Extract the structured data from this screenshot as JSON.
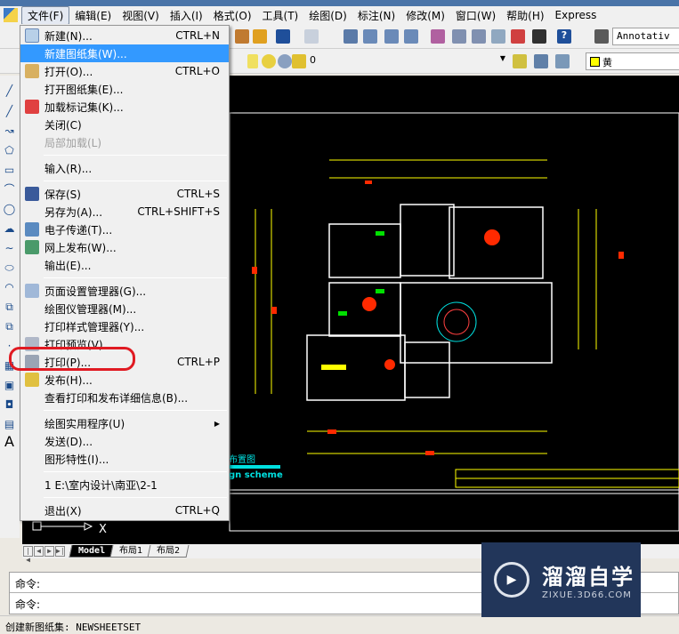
{
  "menubar": {
    "items": [
      "文件(F)",
      "编辑(E)",
      "视图(V)",
      "插入(I)",
      "格式(O)",
      "工具(T)",
      "绘图(D)",
      "标注(N)",
      "修改(M)",
      "窗口(W)",
      "帮助(H)",
      "Express"
    ]
  },
  "toolbar": {
    "text_style": "Annotativ",
    "layer_value": "0",
    "color_value": "黄",
    "accent": "#3399ff"
  },
  "file_menu": {
    "items": [
      {
        "label": "新建(N)...",
        "shortcut": "CTRL+N"
      },
      {
        "label": "新建图纸集(W)...",
        "shortcut": ""
      },
      {
        "label": "打开(O)...",
        "shortcut": "CTRL+O"
      },
      {
        "label": "打开图纸集(E)...",
        "shortcut": ""
      },
      {
        "label": "加载标记集(K)...",
        "shortcut": ""
      },
      {
        "label": "关闭(C)",
        "shortcut": ""
      },
      {
        "label": "局部加载(L)",
        "shortcut": ""
      },
      {
        "label": "输入(R)...",
        "shortcut": ""
      },
      {
        "label": "保存(S)",
        "shortcut": "CTRL+S"
      },
      {
        "label": "另存为(A)...",
        "shortcut": "CTRL+SHIFT+S"
      },
      {
        "label": "电子传递(T)...",
        "shortcut": ""
      },
      {
        "label": "网上发布(W)...",
        "shortcut": ""
      },
      {
        "label": "输出(E)...",
        "shortcut": ""
      },
      {
        "label": "页面设置管理器(G)...",
        "shortcut": ""
      },
      {
        "label": "绘图仪管理器(M)...",
        "shortcut": ""
      },
      {
        "label": "打印样式管理器(Y)...",
        "shortcut": ""
      },
      {
        "label": "打印预览(V)",
        "shortcut": ""
      },
      {
        "label": "打印(P)...",
        "shortcut": "CTRL+P"
      },
      {
        "label": "发布(H)...",
        "shortcut": ""
      },
      {
        "label": "查看打印和发布详细信息(B)...",
        "shortcut": ""
      },
      {
        "label": "绘图实用程序(U)",
        "shortcut": ""
      },
      {
        "label": "发送(D)...",
        "shortcut": ""
      },
      {
        "label": "图形特性(I)...",
        "shortcut": ""
      },
      {
        "label": "1 E:\\室内设计\\南亚\\2-1",
        "shortcut": ""
      },
      {
        "label": "退出(X)",
        "shortcut": "CTRL+Q"
      }
    ]
  },
  "drawing": {
    "title_cn": "布置图",
    "title_en": "gn scheme",
    "ucs_x": "X"
  },
  "layout_tabs": [
    "Model",
    "布局1",
    "布局2"
  ],
  "command": {
    "lines": [
      "命令:",
      "命令:"
    ]
  },
  "status": {
    "text": "创建新图纸集: NEWSHEETSET"
  },
  "watermark": {
    "title": "溜溜自学",
    "url": "ZIXUE.3D66.COM"
  }
}
